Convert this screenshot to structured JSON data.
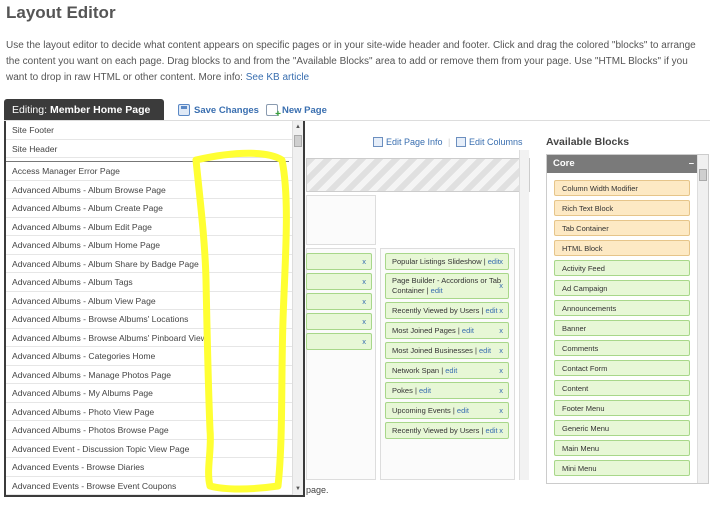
{
  "header": {
    "title": "Layout Editor",
    "intro": "Use the layout editor to decide what content appears on specific pages or in your site-wide header and footer. Click and drag the colored \"blocks\" to arrange the content you want on each page. Drag blocks to and from the \"Available Blocks\" area to add or remove them from your page. Use \"HTML Blocks\" if you want to drop in raw HTML or other content. More info: ",
    "kb_link": "See KB article"
  },
  "toolbar": {
    "editing_label": "Editing:",
    "editing_page": "Member Home Page",
    "save_changes": "Save Changes",
    "new_page": "New Page",
    "edit_page_info": "Edit Page Info",
    "edit_columns": "Edit Columns"
  },
  "dropdown": {
    "top_items": [
      "Site Footer",
      "Site Header"
    ],
    "items": [
      "Access Manager Error Page",
      "Advanced Albums - Album Browse Page",
      "Advanced Albums - Album Create Page",
      "Advanced Albums - Album Edit Page",
      "Advanced Albums - Album Home Page",
      "Advanced Albums - Album Share by Badge Page",
      "Advanced Albums - Album Tags",
      "Advanced Albums - Album View Page",
      "Advanced Albums - Browse Albums' Locations",
      "Advanced Albums - Browse Albums' Pinboard View",
      "Advanced Albums - Categories Home",
      "Advanced Albums - Manage Photos Page",
      "Advanced Albums - My Albums Page",
      "Advanced Albums - Photo View Page",
      "Advanced Albums - Photos Browse Page",
      "Advanced Event - Discussion Topic View Page",
      "Advanced Events - Browse Diaries",
      "Advanced Events - Browse Event Coupons"
    ]
  },
  "layout": {
    "right_column_blocks": [
      {
        "label": "Popular Listings Slideshow",
        "edit": "edit",
        "x": "x"
      },
      {
        "label": "Page Builder - Accordions or Tab Container",
        "edit": "edit",
        "x": "x"
      },
      {
        "label": "Recently Viewed by Users",
        "edit": "edit",
        "x": "x"
      },
      {
        "label": "Most Joined Pages",
        "edit": "edit",
        "x": "x"
      },
      {
        "label": "Most Joined Businesses",
        "edit": "edit",
        "x": "x"
      },
      {
        "label": "Network Span",
        "edit": "edit",
        "x": "x"
      },
      {
        "label": "Pokes",
        "edit": "edit",
        "x": "x"
      },
      {
        "label": "Upcoming Events",
        "edit": "edit",
        "x": "x"
      },
      {
        "label": "Recently Viewed by Users",
        "edit": "edit",
        "x": "x"
      }
    ],
    "left_column_x": "x",
    "page_note": "page."
  },
  "available": {
    "title": "Available Blocks",
    "group": "Core",
    "collapse": "–",
    "blocks": [
      {
        "label": "Column Width Modifier",
        "color": "orange"
      },
      {
        "label": "Rich Text Block",
        "color": "orange"
      },
      {
        "label": "Tab Container",
        "color": "orange"
      },
      {
        "label": "HTML Block",
        "color": "orange"
      },
      {
        "label": "Activity Feed",
        "color": "green"
      },
      {
        "label": "Ad Campaign",
        "color": "green"
      },
      {
        "label": "Announcements",
        "color": "green"
      },
      {
        "label": "Banner",
        "color": "green"
      },
      {
        "label": "Comments",
        "color": "green"
      },
      {
        "label": "Contact Form",
        "color": "green"
      },
      {
        "label": "Content",
        "color": "green"
      },
      {
        "label": "Footer Menu",
        "color": "green"
      },
      {
        "label": "Generic Menu",
        "color": "green"
      },
      {
        "label": "Main Menu",
        "color": "green"
      },
      {
        "label": "Mini Menu",
        "color": "green"
      }
    ]
  },
  "colors": {
    "annotation": "#ffff33",
    "dark_button": "#3b3b3b",
    "link": "#3a6fb0"
  }
}
